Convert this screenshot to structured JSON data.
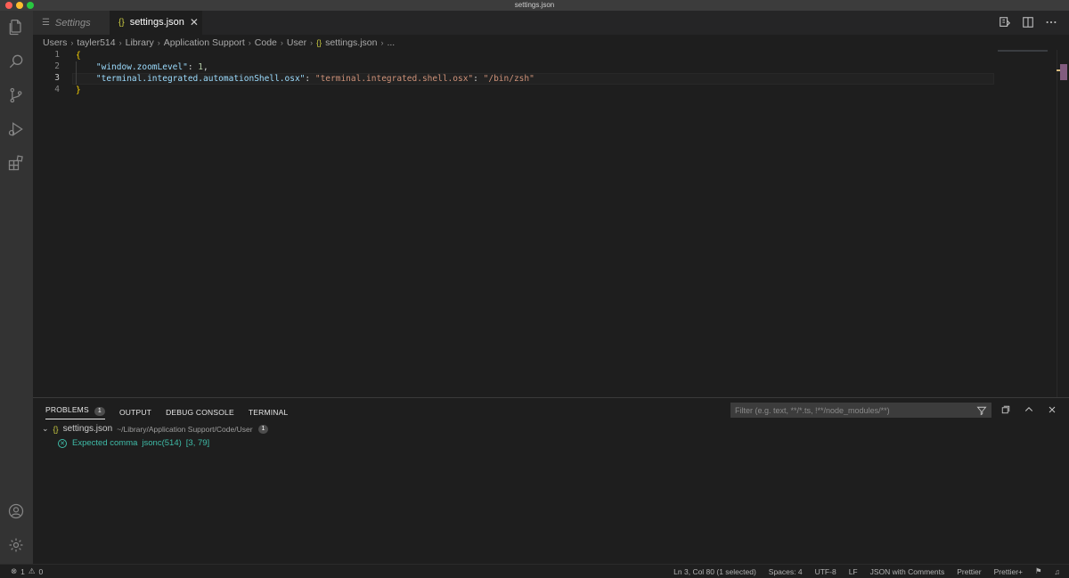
{
  "window": {
    "title": "settings.json"
  },
  "tabs": [
    {
      "label": "Settings"
    },
    {
      "label": "settings.json"
    }
  ],
  "breadcrumbs": [
    "Users",
    "tayler514",
    "Library",
    "Application Support",
    "Code",
    "User",
    "settings.json",
    "..."
  ],
  "editor": {
    "lines": [
      {
        "no": "1"
      },
      {
        "no": "2",
        "key": "\"window.zoomLevel\"",
        "value": "1"
      },
      {
        "no": "3",
        "key": "\"terminal.integrated.automationShell.osx\"",
        "key2": "\"terminal.integrated.shell.osx\"",
        "value": "\"/bin/zsh\""
      },
      {
        "no": "4"
      }
    ]
  },
  "panel": {
    "tabs": [
      "PROBLEMS",
      "OUTPUT",
      "DEBUG CONSOLE",
      "TERMINAL"
    ],
    "problems_count": "1",
    "filter_placeholder": "Filter (e.g. text, **/*.ts, !**/node_modules/**)",
    "file": {
      "name": "settings.json",
      "path": "~/Library/Application Support/Code/User",
      "count": "1"
    },
    "problem": {
      "message": "Expected comma",
      "source": "jsonc(514)",
      "location": "[3, 79]"
    }
  },
  "statusbar": {
    "errors": "1",
    "warnings": "0",
    "position": "Ln 3, Col 80 (1 selected)",
    "spaces": "Spaces: 4",
    "encoding": "UTF-8",
    "eol": "LF",
    "language": "JSON with Comments",
    "prettier": "Prettier",
    "prettier_plus": "Prettier+"
  },
  "colors": {
    "accent_error": "#3fbca8",
    "brace": "#ffd700",
    "key": "#9cdcfe",
    "string": "#ce9178",
    "number": "#b5cea8"
  }
}
